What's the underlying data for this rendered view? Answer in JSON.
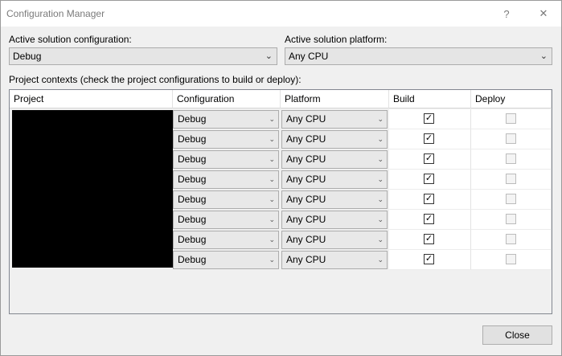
{
  "window": {
    "title": "Configuration Manager",
    "help_glyph": "?",
    "close_glyph": "✕"
  },
  "active_config": {
    "label": "Active solution configuration:",
    "value": "Debug"
  },
  "active_platform": {
    "label": "Active solution platform:",
    "value": "Any CPU"
  },
  "contexts_label": "Project contexts (check the project configurations to build or deploy):",
  "grid": {
    "columns": [
      "Project",
      "Configuration",
      "Platform",
      "Build",
      "Deploy"
    ],
    "rows": [
      {
        "configuration": "Debug",
        "platform": "Any CPU",
        "build": true,
        "deploy": false
      },
      {
        "configuration": "Debug",
        "platform": "Any CPU",
        "build": true,
        "deploy": false
      },
      {
        "configuration": "Debug",
        "platform": "Any CPU",
        "build": true,
        "deploy": false
      },
      {
        "configuration": "Debug",
        "platform": "Any CPU",
        "build": true,
        "deploy": false
      },
      {
        "configuration": "Debug",
        "platform": "Any CPU",
        "build": true,
        "deploy": false
      },
      {
        "configuration": "Debug",
        "platform": "Any CPU",
        "build": true,
        "deploy": false
      },
      {
        "configuration": "Debug",
        "platform": "Any CPU",
        "build": true,
        "deploy": false
      },
      {
        "configuration": "Debug",
        "platform": "Any CPU",
        "build": true,
        "deploy": false
      }
    ]
  },
  "buttons": {
    "close": "Close"
  },
  "icons": {
    "dropdown": "chevron-down-icon",
    "check": "checkmark-icon"
  }
}
